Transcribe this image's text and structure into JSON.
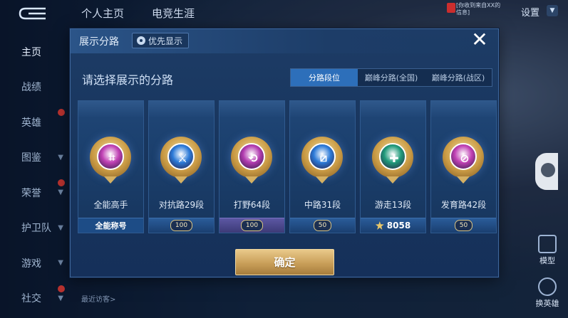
{
  "topbar": {
    "tabs": [
      "个人主页",
      "电竞生涯"
    ],
    "settings_label": "设置",
    "message_text": "[你收到来自XX的信息]"
  },
  "sidebar": {
    "items": [
      {
        "label": "主页",
        "active": true,
        "badge": false,
        "arrow": false
      },
      {
        "label": "战绩",
        "active": false,
        "badge": false,
        "arrow": false
      },
      {
        "label": "英雄",
        "active": false,
        "badge": true,
        "arrow": false
      },
      {
        "label": "图鉴",
        "active": false,
        "badge": false,
        "arrow": true
      },
      {
        "label": "荣誉",
        "active": false,
        "badge": true,
        "arrow": true
      },
      {
        "label": "护卫队",
        "active": false,
        "badge": false,
        "arrow": true
      },
      {
        "label": "游戏",
        "active": false,
        "badge": false,
        "arrow": true
      },
      {
        "label": "社交",
        "active": false,
        "badge": true,
        "arrow": true
      }
    ]
  },
  "right": {
    "model_label": "模型",
    "switch_label": "换英雄"
  },
  "recent_label": "最近访客>",
  "modal": {
    "title": "展示分路",
    "priority_label": "优先显示",
    "close_icon": "close-icon",
    "subtitle": "请选择展示的分路",
    "tabs": [
      {
        "label": "分路段位",
        "active": true
      },
      {
        "label": "巅峰分路(全国)",
        "active": false
      },
      {
        "label": "巅峰分路(战区)",
        "active": false
      }
    ],
    "cards": [
      {
        "name": "全能高手",
        "foot": "全能称号",
        "foot_type": "text",
        "emblem_color": "#c040b4",
        "glyph": "⌗"
      },
      {
        "name": "对抗路29段",
        "foot": "100",
        "foot_type": "badge",
        "emblem_color": "#2b7ad8",
        "glyph": "⚔"
      },
      {
        "name": "打野64段",
        "foot": "100",
        "foot_type": "badge-purple",
        "emblem_color": "#b23bb0",
        "glyph": "⟲"
      },
      {
        "name": "中路31段",
        "foot": "50",
        "foot_type": "badge",
        "emblem_color": "#2b7ad8",
        "glyph": "⧄"
      },
      {
        "name": "游走13段",
        "foot": "8058",
        "foot_type": "score",
        "emblem_color": "#1f9a7a",
        "glyph": "✚"
      },
      {
        "name": "发育路42段",
        "foot": "50",
        "foot_type": "badge",
        "emblem_color": "#c040b4",
        "glyph": "⊘"
      }
    ],
    "confirm_label": "确定"
  }
}
